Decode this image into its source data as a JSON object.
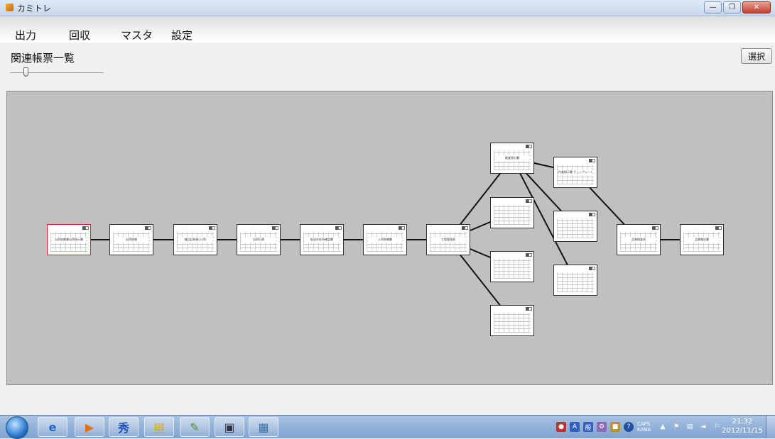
{
  "window": {
    "title": "カミトレ"
  },
  "menu": {
    "items": [
      "出力",
      "回収",
      "マスタ",
      "設定"
    ]
  },
  "panel": {
    "title": "関連帳票一覧",
    "select_label": "選択",
    "zoom_slider_value": 0.15
  },
  "graph": {
    "nodes": [
      {
        "id": "n1",
        "label": "出荷依頼兼出荷指示書",
        "selected": true
      },
      {
        "id": "n2",
        "label": "出荷依頼"
      },
      {
        "id": "n3",
        "label": "検品記録表(入荷)"
      },
      {
        "id": "n4",
        "label": "出荷伝票"
      },
      {
        "id": "n5",
        "label": "配送先住所確認書"
      },
      {
        "id": "n6",
        "label": "入荷依頼書"
      },
      {
        "id": "n7",
        "label": "工程管理表"
      },
      {
        "id": "n8",
        "label": "検査指示書"
      },
      {
        "id": "n9",
        "label": ""
      },
      {
        "id": "n10",
        "label": ""
      },
      {
        "id": "n11",
        "label": ""
      },
      {
        "id": "n12",
        "label": "作業指示書 チェックシート"
      },
      {
        "id": "n13",
        "label": ""
      },
      {
        "id": "n14",
        "label": ""
      },
      {
        "id": "n15",
        "label": "品質検査表"
      },
      {
        "id": "n16",
        "label": "品質報告書"
      }
    ],
    "edges": [
      [
        "n1",
        "n2"
      ],
      [
        "n2",
        "n3"
      ],
      [
        "n3",
        "n4"
      ],
      [
        "n4",
        "n5"
      ],
      [
        "n5",
        "n6"
      ],
      [
        "n6",
        "n7"
      ],
      [
        "n7",
        "n8"
      ],
      [
        "n7",
        "n9"
      ],
      [
        "n7",
        "n10"
      ],
      [
        "n7",
        "n11"
      ],
      [
        "n8",
        "n12"
      ],
      [
        "n8",
        "n13"
      ],
      [
        "n8",
        "n14"
      ],
      [
        "n12",
        "n15"
      ],
      [
        "n15",
        "n16"
      ]
    ]
  },
  "taskbar": {
    "apps": [
      "start-orb",
      "ie-icon",
      "media-player-icon",
      "hidemaru-icon",
      "explorer-icon",
      "paint-icon",
      "window-icon",
      "picture-icon"
    ],
    "tray_text": [
      "CAPS",
      "KANA"
    ],
    "time": "21:32",
    "date": "2012/11/15"
  }
}
